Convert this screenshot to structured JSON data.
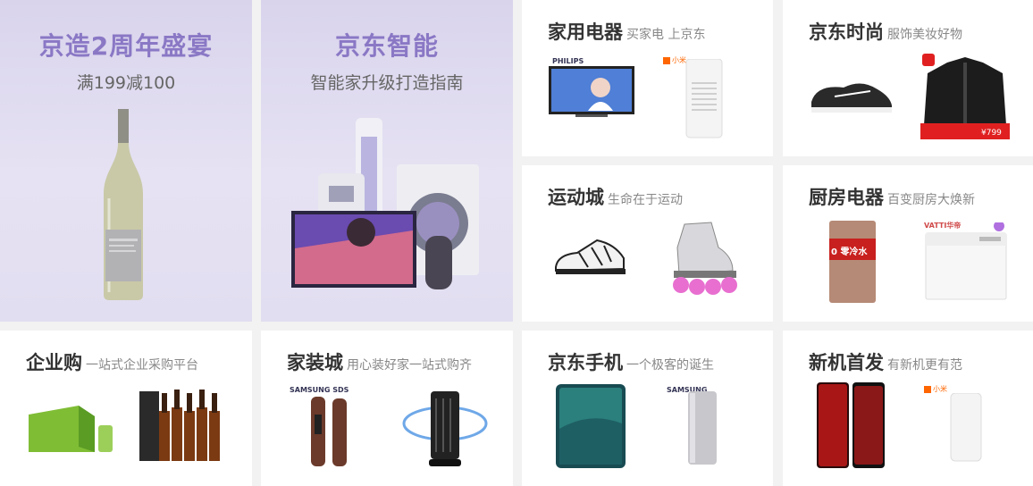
{
  "tiles": {
    "jingzao": {
      "title": "京造2周年盛宴",
      "subtitle": "满199减100"
    },
    "smart": {
      "title": "京东智能",
      "subtitle": "智能家升级打造指南"
    },
    "appliance": {
      "title": "家用电器",
      "subtitle": "买家电 上京东",
      "brand": "PHILIPS",
      "mi": "小米"
    },
    "fashion": {
      "title": "京东时尚",
      "subtitle": "服饰美妆好物",
      "price": "¥799"
    },
    "sports": {
      "title": "运动城",
      "subtitle": "生命在于运动"
    },
    "kitchen": {
      "title": "厨房电器",
      "subtitle": "百变厨房大焕新",
      "tag": "0 零冷水",
      "brand": "VATTI华帝"
    },
    "enterprise": {
      "title": "企业购",
      "subtitle": "一站式企业采购平台"
    },
    "home": {
      "title": "家装城",
      "subtitle": "用心装好家一站式购齐",
      "brand": "SAMSUNG SDS"
    },
    "phone": {
      "title": "京东手机",
      "subtitle": "一个极客的诞生",
      "brand": "SAMSUNG"
    },
    "newdevice": {
      "title": "新机首发",
      "subtitle": "有新机更有范",
      "mi": "小米"
    }
  }
}
